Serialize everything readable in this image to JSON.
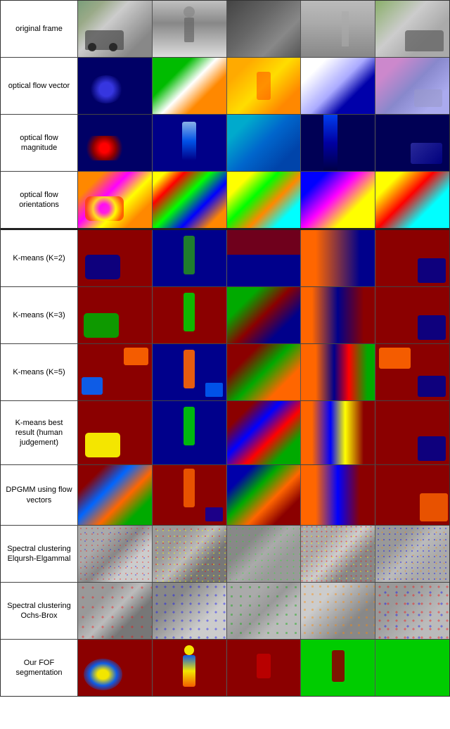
{
  "rows": [
    {
      "id": "original-frame",
      "label": "original frame",
      "cells": [
        "orig-1",
        "orig-2",
        "orig-3",
        "orig-4",
        "orig-5"
      ]
    },
    {
      "id": "optical-flow-vector",
      "label": "optical flow vector",
      "cells": [
        "ofv-1",
        "ofv-2",
        "ofv-3",
        "ofv-4",
        "ofv-5"
      ]
    },
    {
      "id": "optical-flow-magnitude",
      "label": "optical flow magnitude",
      "cells": [
        "ofm-1",
        "ofm-2",
        "ofm-3",
        "ofm-4",
        "ofm-5"
      ]
    },
    {
      "id": "optical-flow-orientations",
      "label": "optical flow orientations",
      "cells": [
        "ofo-1",
        "ofo-2",
        "ofo-3",
        "ofo-4",
        "ofo-5"
      ]
    }
  ],
  "rows2": [
    {
      "id": "kmeans-k2",
      "label": "K-means (K=2)",
      "cells": [
        "km2-1",
        "km2-2",
        "km2-3",
        "km2-4",
        "km2-5"
      ]
    },
    {
      "id": "kmeans-k3",
      "label": "K-means (K=3)",
      "cells": [
        "km3-1",
        "km3-2",
        "km3-3",
        "km3-4",
        "km3-5"
      ]
    },
    {
      "id": "kmeans-k5",
      "label": "K-means (K=5)",
      "cells": [
        "km5-1",
        "km5-2",
        "km5-3",
        "km5-4",
        "km5-5"
      ]
    },
    {
      "id": "kmeans-best",
      "label": "K-means best result (human judgement)",
      "cells": [
        "kmbest-1",
        "kmbest-2",
        "kmbest-3",
        "kmbest-4",
        "kmbest-5"
      ]
    },
    {
      "id": "dpgmm",
      "label": "DPGMM using flow vectors",
      "cells": [
        "dpgmm-1",
        "dpgmm-2",
        "dpgmm-3",
        "dpgmm-4",
        "dpgmm-5"
      ]
    },
    {
      "id": "spectral-elqursh",
      "label": "Spectral clustering Elqursh-Elgammal",
      "cells": [
        "spec1-1",
        "spec1-2",
        "spec1-3",
        "spec1-4",
        "spec1-5"
      ]
    },
    {
      "id": "spectral-ochs",
      "label": "Spectral clustering Ochs-Brox",
      "cells": [
        "spec2-1",
        "spec2-2",
        "spec2-3",
        "spec2-4",
        "spec2-5"
      ]
    },
    {
      "id": "fof",
      "label": "Our FOF segmentation",
      "cells": [
        "fof-1",
        "fof-2",
        "fof-3",
        "fof-4",
        "fof-5"
      ]
    }
  ]
}
